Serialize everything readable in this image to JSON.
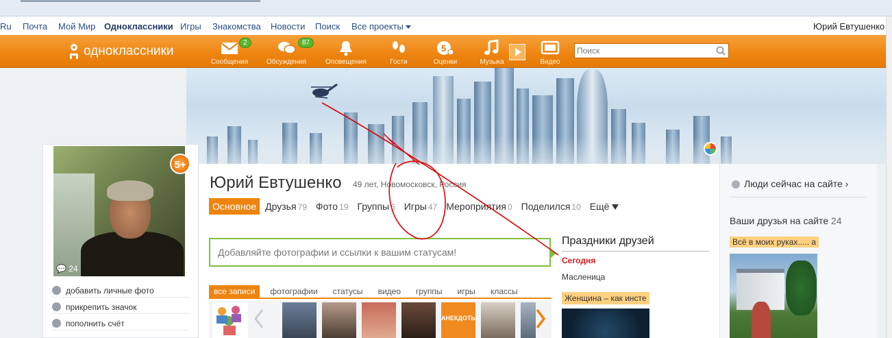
{
  "portal": {
    "links": [
      "Ru",
      "Почта",
      "Мой Мир",
      "Одноклассники",
      "Игры",
      "Знакомства",
      "Новости",
      "Поиск",
      "Все проекты"
    ],
    "user": "Юрий Евтушенко"
  },
  "toolbar": {
    "logo": "одноклассники",
    "items": [
      {
        "label": "Сообщения",
        "icon": "envelope-icon",
        "count": "2"
      },
      {
        "label": "Обсуждения",
        "icon": "chat-bubbles-icon",
        "count": "87"
      },
      {
        "label": "Оповещения",
        "icon": "bell-icon",
        "count": ""
      },
      {
        "label": "Гости",
        "icon": "footprints-icon",
        "count": ""
      },
      {
        "label": "Оценки",
        "icon": "rating-5-icon",
        "count": ""
      },
      {
        "label": "Музыка",
        "icon": "music-note-icon",
        "count": ""
      },
      {
        "label": "Видео",
        "icon": "video-icon",
        "count": ""
      }
    ],
    "search_placeholder": "Поиск"
  },
  "profile": {
    "name": "Юрий Евтушенко",
    "meta": "49 лет, Новомосковск, Россия",
    "badge": "5+",
    "avatar_comments": "24",
    "left_menu": [
      "добавить личные фото",
      "прикрепить значок",
      "пополнить счёт"
    ]
  },
  "tabs": [
    {
      "label": "Основное",
      "count": ""
    },
    {
      "label": "Друзья",
      "count": "79"
    },
    {
      "label": "Фото",
      "count": "19"
    },
    {
      "label": "Группы",
      "count": "6"
    },
    {
      "label": "Игры",
      "count": "47"
    },
    {
      "label": "Мероприятия",
      "count": "0"
    },
    {
      "label": "Поделился",
      "count": "10"
    },
    {
      "label": "Ещё",
      "count": ""
    }
  ],
  "status_placeholder": "Добавляйте фотографии и ссылки к вашим статусам!",
  "feed_tabs": [
    "все записи",
    "фотографии",
    "статусы",
    "видео",
    "группы",
    "игры",
    "классы"
  ],
  "feed_thumb_label": "АНЕКДОТЫ",
  "holidays": {
    "title": "Праздники друзей",
    "today": "Сегодня",
    "name": "Масленица",
    "next": "Женщина – как инсте"
  },
  "right": {
    "online": "Люди сейчас на сайте ›",
    "friends_title": "Ваши друзья на сайте",
    "friends_count": "24",
    "friend_status": "Всё в моих руках..... а"
  },
  "colors": {
    "brand": "#ee8410",
    "status_border": "#7fc13c",
    "annotation": "#e00000"
  }
}
